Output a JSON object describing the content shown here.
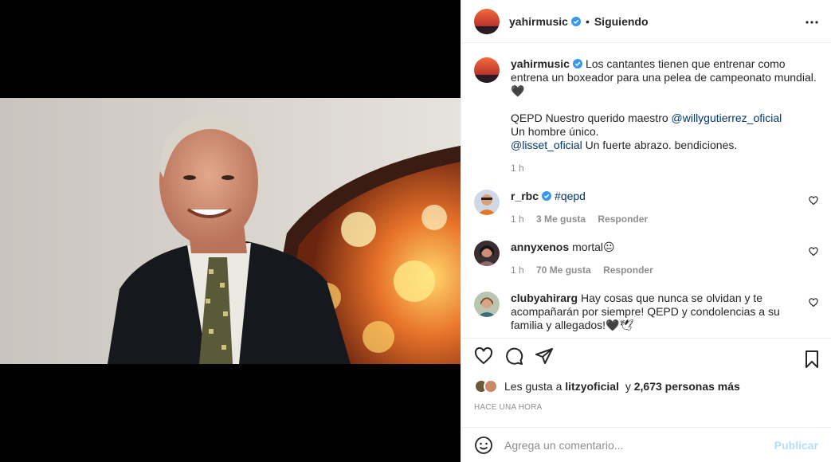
{
  "header": {
    "username": "yahirmusic",
    "separator": "•",
    "follow_status": "Siguiendo",
    "more_icon": "more-horizontal-icon"
  },
  "caption": {
    "username": "yahirmusic",
    "line1": "Los cantantes tienen que entrenar como entrena un boxeador para una pelea de campeonato mundial.",
    "line1_emoji": "🖤",
    "line2_prefix": "QEPD Nuestro querido maestro ",
    "line2_mention": "@willygutierrez_oficial",
    "line3": "Un hombre único.",
    "line4_mention": "@lisset_oficial",
    "line4_suffix": " Un fuerte abrazo. bendiciones.",
    "time": "1 h"
  },
  "comments": [
    {
      "username": "r_rbc",
      "verified": true,
      "text": "",
      "hashtag": "#qepd",
      "time": "1 h",
      "likes": "3 Me gusta",
      "reply": "Responder"
    },
    {
      "username": "annyxenos",
      "verified": false,
      "text": "mortal",
      "emoji": "😐",
      "time": "1 h",
      "likes": "70 Me gusta",
      "reply": "Responder"
    },
    {
      "username": "clubyahirarg",
      "verified": false,
      "text": "Hay cosas que nunca se olvidan y te acompañarán por siempre! QEPD y condolencias a su familia y allegados!",
      "emoji": "🖤🕊",
      "time": "",
      "likes": "",
      "reply": ""
    }
  ],
  "likes": {
    "prefix": "Les gusta a ",
    "user": "litzyoficial",
    "middle": " y ",
    "count": "2,673 personas más"
  },
  "time_ago": "HACE UNA HORA",
  "add_comment": {
    "placeholder": "Agrega un comentario...",
    "post_label": "Publicar"
  },
  "colors": {
    "verified": "#3897f0",
    "link": "#00376b",
    "muted": "#8e8e8e",
    "post_disabled": "#b2dffc"
  }
}
